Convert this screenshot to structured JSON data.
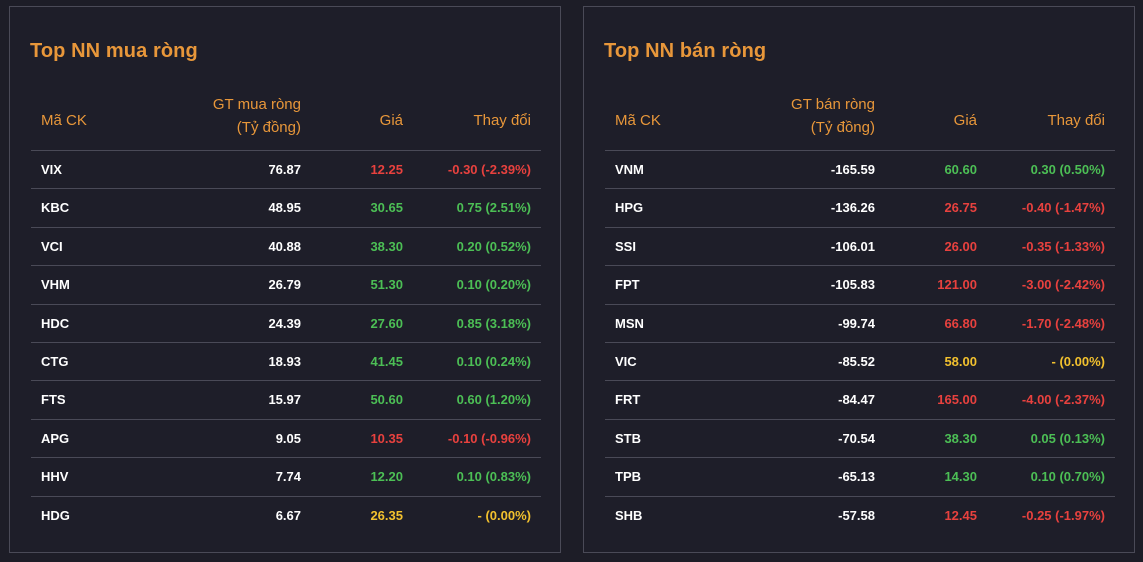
{
  "colors": {
    "up": "#4cbf55",
    "down": "#e8413e",
    "ref": "#f2c12e",
    "header": "#e8973a"
  },
  "buy_panel": {
    "title": "Top NN mua ròng",
    "headers": {
      "code": "Mã CK",
      "value_line1": "GT mua ròng",
      "value_line2": "(Tỷ đồng)",
      "price": "Giá",
      "change": "Thay đổi"
    },
    "rows": [
      {
        "code": "VIX",
        "value": "76.87",
        "price": "12.25",
        "change": "-0.30 (-2.39%)",
        "trend": "down"
      },
      {
        "code": "KBC",
        "value": "48.95",
        "price": "30.65",
        "change": "0.75 (2.51%)",
        "trend": "up"
      },
      {
        "code": "VCI",
        "value": "40.88",
        "price": "38.30",
        "change": "0.20 (0.52%)",
        "trend": "up"
      },
      {
        "code": "VHM",
        "value": "26.79",
        "price": "51.30",
        "change": "0.10 (0.20%)",
        "trend": "up"
      },
      {
        "code": "HDC",
        "value": "24.39",
        "price": "27.60",
        "change": "0.85 (3.18%)",
        "trend": "up"
      },
      {
        "code": "CTG",
        "value": "18.93",
        "price": "41.45",
        "change": "0.10 (0.24%)",
        "trend": "up"
      },
      {
        "code": "FTS",
        "value": "15.97",
        "price": "50.60",
        "change": "0.60 (1.20%)",
        "trend": "up"
      },
      {
        "code": "APG",
        "value": "9.05",
        "price": "10.35",
        "change": "-0.10 (-0.96%)",
        "trend": "down"
      },
      {
        "code": "HHV",
        "value": "7.74",
        "price": "12.20",
        "change": "0.10 (0.83%)",
        "trend": "up"
      },
      {
        "code": "HDG",
        "value": "6.67",
        "price": "26.35",
        "change": "- (0.00%)",
        "trend": "ref"
      }
    ]
  },
  "sell_panel": {
    "title": "Top NN bán ròng",
    "headers": {
      "code": "Mã CK",
      "value_line1": "GT bán ròng",
      "value_line2": "(Tỷ đồng)",
      "price": "Giá",
      "change": "Thay đổi"
    },
    "rows": [
      {
        "code": "VNM",
        "value": "-165.59",
        "price": "60.60",
        "change": "0.30 (0.50%)",
        "trend": "up"
      },
      {
        "code": "HPG",
        "value": "-136.26",
        "price": "26.75",
        "change": "-0.40 (-1.47%)",
        "trend": "down"
      },
      {
        "code": "SSI",
        "value": "-106.01",
        "price": "26.00",
        "change": "-0.35 (-1.33%)",
        "trend": "down"
      },
      {
        "code": "FPT",
        "value": "-105.83",
        "price": "121.00",
        "change": "-3.00 (-2.42%)",
        "trend": "down"
      },
      {
        "code": "MSN",
        "value": "-99.74",
        "price": "66.80",
        "change": "-1.70 (-2.48%)",
        "trend": "down"
      },
      {
        "code": "VIC",
        "value": "-85.52",
        "price": "58.00",
        "change": "- (0.00%)",
        "trend": "ref"
      },
      {
        "code": "FRT",
        "value": "-84.47",
        "price": "165.00",
        "change": "-4.00 (-2.37%)",
        "trend": "down"
      },
      {
        "code": "STB",
        "value": "-70.54",
        "price": "38.30",
        "change": "0.05 (0.13%)",
        "trend": "up"
      },
      {
        "code": "TPB",
        "value": "-65.13",
        "price": "14.30",
        "change": "0.10 (0.70%)",
        "trend": "up"
      },
      {
        "code": "SHB",
        "value": "-57.58",
        "price": "12.45",
        "change": "-0.25 (-1.97%)",
        "trend": "down"
      }
    ]
  }
}
